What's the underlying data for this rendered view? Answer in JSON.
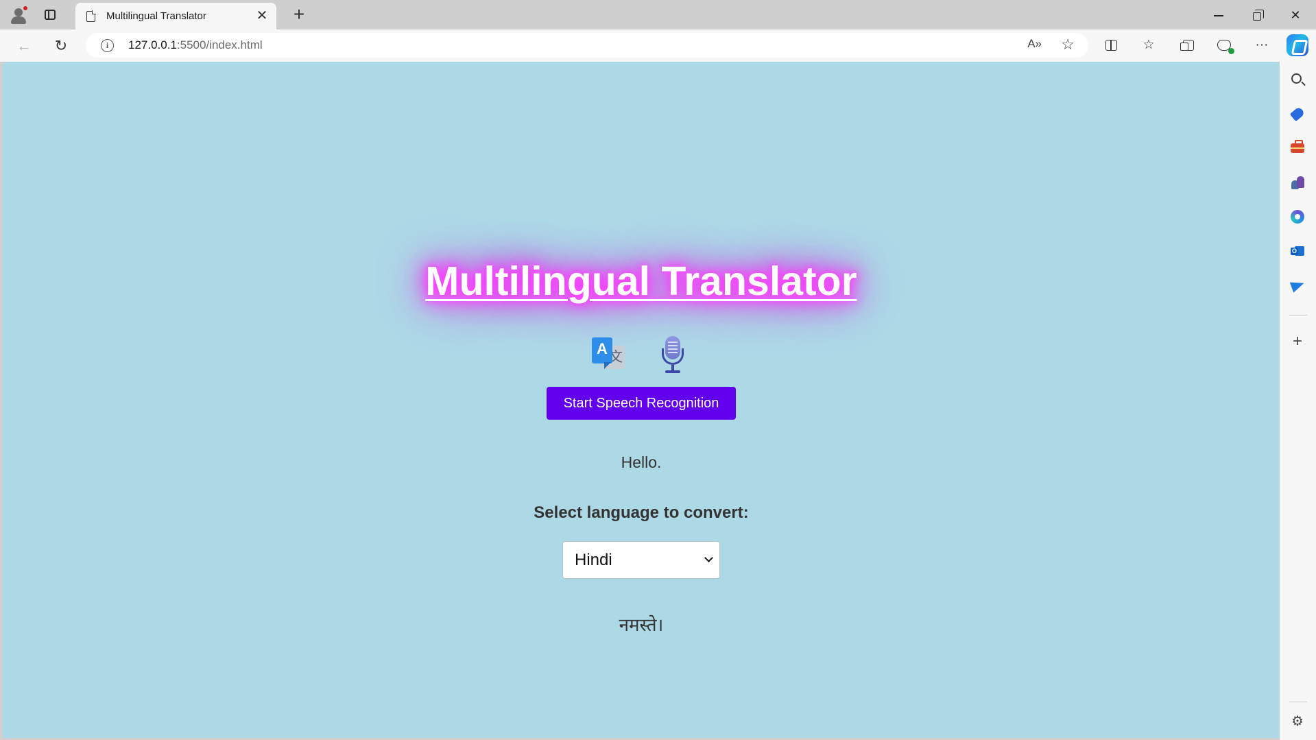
{
  "browser": {
    "tab_title": "Multilingual Translator",
    "tab_close": "✕",
    "new_tab": "+",
    "url_host": "127.0.0.1",
    "url_rest": ":5500/index.html",
    "read_aloud": "A»",
    "favorite": "☆",
    "back": "←",
    "refresh": "↻",
    "more": "···",
    "close_window": "✕",
    "sidebar_add": "+",
    "sidebar_settings": "⚙"
  },
  "page": {
    "title": "Multilingual Translator",
    "translate_icon_front": "A",
    "translate_icon_back": "文",
    "start_button": "Start Speech Recognition",
    "recognized_text": "Hello.",
    "select_label": "Select language to convert:",
    "selected_language": "Hindi",
    "translated_text": "नमस्ते।"
  },
  "colors": {
    "page_background": "#add8e6",
    "title_glow": "#ff33ff",
    "button_background": "#6200ee",
    "button_text": "#ffffff",
    "body_text": "#333333"
  }
}
